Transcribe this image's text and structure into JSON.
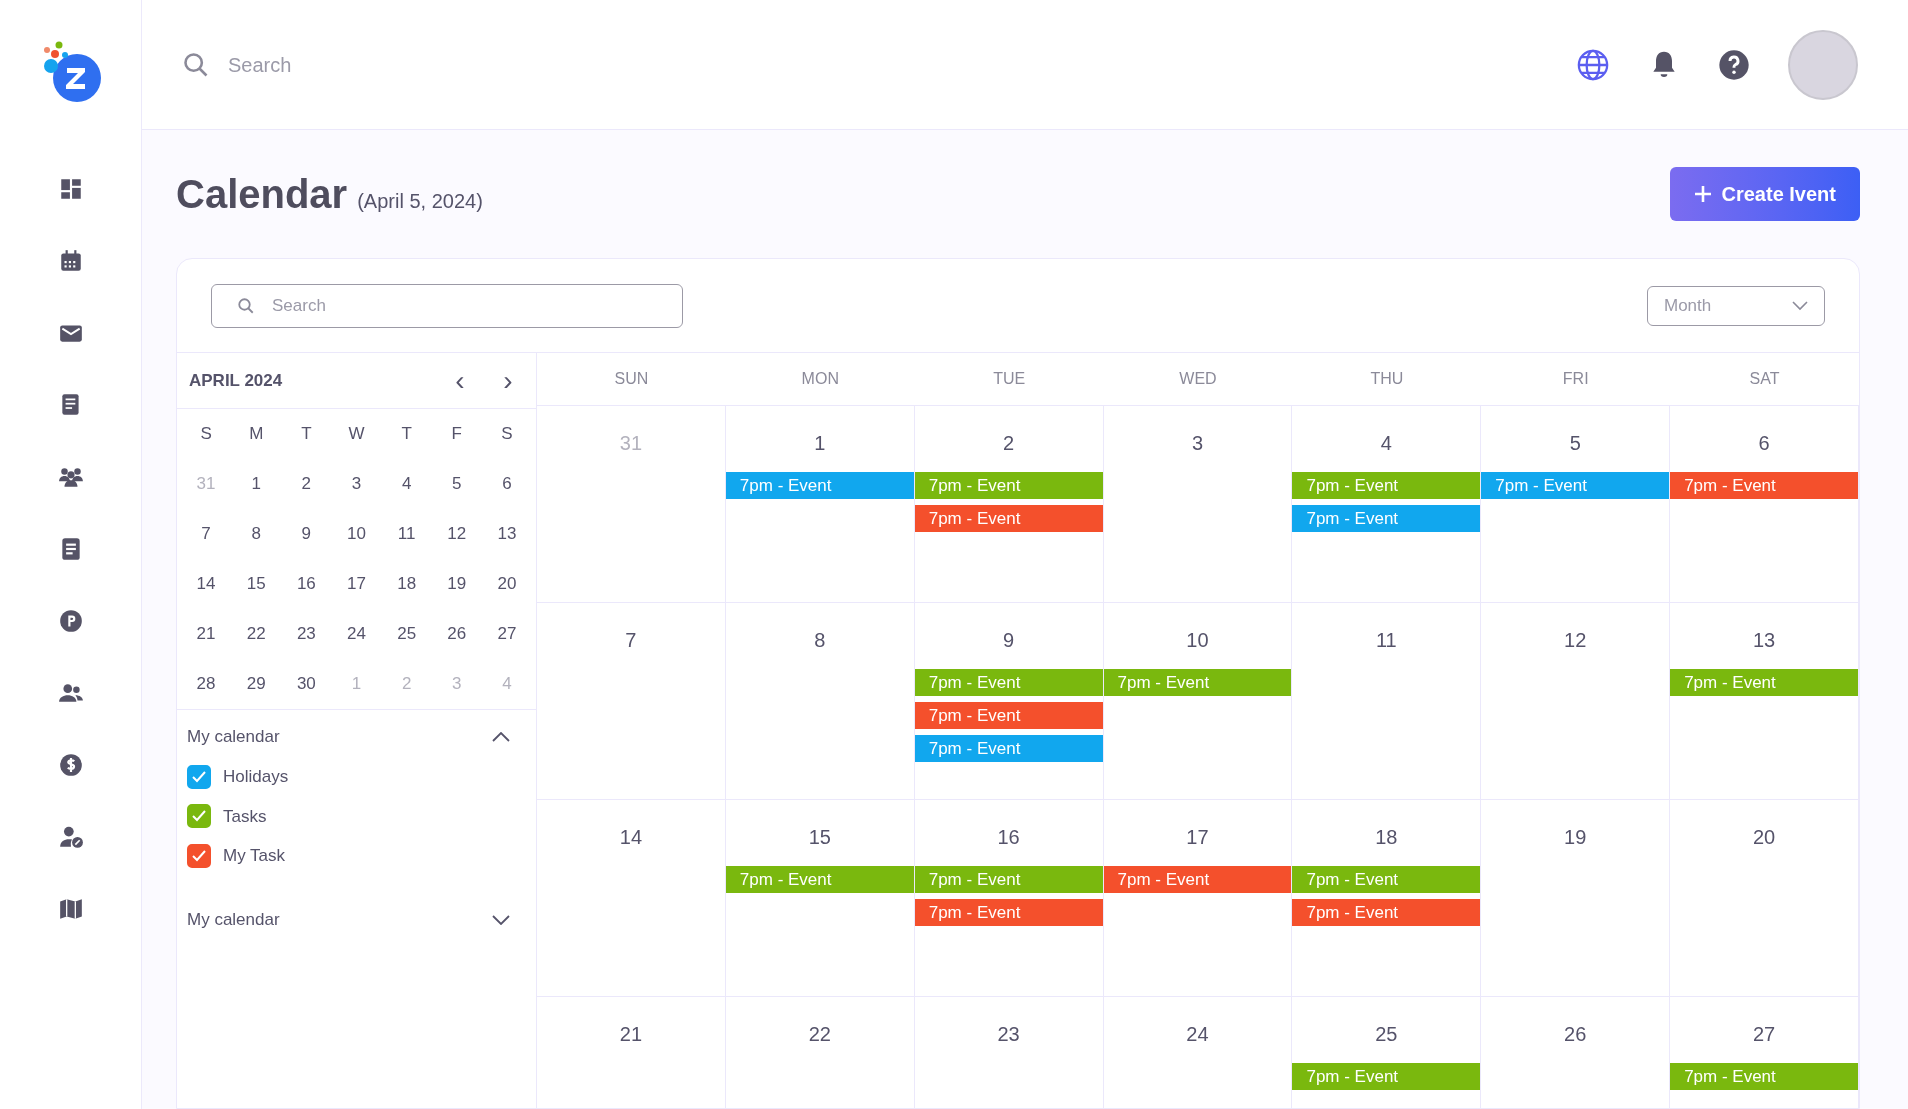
{
  "topbar": {
    "search": {
      "placeholder": "Search"
    }
  },
  "page": {
    "title": "Calendar",
    "date": "(April 5, 2024)",
    "create_button": "Create Ivent"
  },
  "toolbar": {
    "search": {
      "placeholder": "Search"
    },
    "view": {
      "value": "Month"
    }
  },
  "mini_calendar": {
    "month": "APRIL 2024",
    "prev": "‹",
    "next": "›",
    "weekdays": [
      "S",
      "M",
      "T",
      "W",
      "T",
      "F",
      "S"
    ],
    "weeks": [
      [
        {
          "label": "31",
          "muted": true
        },
        {
          "label": "1",
          "muted": false
        },
        {
          "label": "2",
          "muted": false
        },
        {
          "label": "3",
          "muted": false
        },
        {
          "label": "4",
          "muted": false
        },
        {
          "label": "5",
          "muted": false
        },
        {
          "label": "6",
          "muted": false
        }
      ],
      [
        {
          "label": "7",
          "muted": false
        },
        {
          "label": "8",
          "muted": false
        },
        {
          "label": "9",
          "muted": false
        },
        {
          "label": "10",
          "muted": false
        },
        {
          "label": "11",
          "muted": false
        },
        {
          "label": "12",
          "muted": false
        },
        {
          "label": "13",
          "muted": false
        }
      ],
      [
        {
          "label": "14",
          "muted": false
        },
        {
          "label": "15",
          "muted": false
        },
        {
          "label": "16",
          "muted": false
        },
        {
          "label": "17",
          "muted": false
        },
        {
          "label": "18",
          "muted": false
        },
        {
          "label": "19",
          "muted": false
        },
        {
          "label": "20",
          "muted": false
        }
      ],
      [
        {
          "label": "21",
          "muted": false
        },
        {
          "label": "22",
          "muted": false
        },
        {
          "label": "23",
          "muted": false
        },
        {
          "label": "24",
          "muted": false
        },
        {
          "label": "25",
          "muted": false
        },
        {
          "label": "26",
          "muted": false
        },
        {
          "label": "27",
          "muted": false
        }
      ],
      [
        {
          "label": "28",
          "muted": false
        },
        {
          "label": "29",
          "muted": false
        },
        {
          "label": "30",
          "muted": false
        },
        {
          "label": "1",
          "muted": true
        },
        {
          "label": "2",
          "muted": true
        },
        {
          "label": "3",
          "muted": true
        },
        {
          "label": "4",
          "muted": true
        }
      ]
    ]
  },
  "calendar_groups": [
    {
      "title": "My calendar",
      "expanded": true,
      "items": [
        {
          "label": "Holidays",
          "checked": true,
          "color": "#11a7ee"
        },
        {
          "label": "Tasks",
          "checked": true,
          "color": "#7ab80e"
        },
        {
          "label": "My Task",
          "checked": true,
          "color": "#f4502c"
        }
      ]
    },
    {
      "title": "My calendar",
      "expanded": false
    }
  ],
  "month_view": {
    "columns": [
      "SUN",
      "MON",
      "TUE",
      "WED",
      "THU",
      "FRI",
      "SAT"
    ],
    "weeks": [
      [
        {
          "label": "31",
          "muted": true
        },
        {
          "label": "1",
          "muted": false,
          "events": [
            {
              "label": "7pm - Event",
              "color": "#11a7ee"
            }
          ]
        },
        {
          "label": "2",
          "muted": false,
          "events": [
            {
              "label": "7pm - Event",
              "color": "#7ab80e"
            },
            {
              "label": "7pm - Event",
              "color": "#f4502c"
            }
          ]
        },
        {
          "label": "3",
          "muted": false
        },
        {
          "label": "4",
          "muted": false,
          "events": [
            {
              "label": "7pm - Event",
              "color": "#7ab80e"
            },
            {
              "label": "7pm - Event",
              "color": "#11a7ee"
            }
          ]
        },
        {
          "label": "5",
          "muted": false,
          "events": [
            {
              "label": "7pm - Event",
              "color": "#11a7ee"
            }
          ]
        },
        {
          "label": "6",
          "muted": false,
          "events": [
            {
              "label": "7pm - Event",
              "color": "#f4502c"
            }
          ]
        }
      ],
      [
        {
          "label": "7",
          "muted": false
        },
        {
          "label": "8",
          "muted": false
        },
        {
          "label": "9",
          "muted": false,
          "events": [
            {
              "label": "7pm - Event",
              "color": "#7ab80e"
            },
            {
              "label": "7pm - Event",
              "color": "#f4502c"
            },
            {
              "label": "7pm - Event",
              "color": "#11a7ee"
            }
          ]
        },
        {
          "label": "10",
          "muted": false,
          "events": [
            {
              "label": "7pm - Event",
              "color": "#7ab80e"
            }
          ]
        },
        {
          "label": "11",
          "muted": false
        },
        {
          "label": "12",
          "muted": false
        },
        {
          "label": "13",
          "muted": false,
          "events": [
            {
              "label": "7pm - Event",
              "color": "#7ab80e"
            }
          ]
        }
      ],
      [
        {
          "label": "14",
          "muted": false
        },
        {
          "label": "15",
          "muted": false,
          "events": [
            {
              "label": "7pm - Event",
              "color": "#7ab80e"
            }
          ]
        },
        {
          "label": "16",
          "muted": false,
          "events": [
            {
              "label": "7pm - Event",
              "color": "#7ab80e"
            },
            {
              "label": "7pm - Event",
              "color": "#f4502c"
            }
          ]
        },
        {
          "label": "17",
          "muted": false,
          "events": [
            {
              "label": "7pm - Event",
              "color": "#f4502c"
            }
          ]
        },
        {
          "label": "18",
          "muted": false,
          "events": [
            {
              "label": "7pm - Event",
              "color": "#7ab80e"
            },
            {
              "label": "7pm - Event",
              "color": "#f4502c"
            }
          ]
        },
        {
          "label": "19",
          "muted": false
        },
        {
          "label": "20",
          "muted": false
        }
      ],
      [
        {
          "label": "21",
          "muted": false
        },
        {
          "label": "22",
          "muted": false
        },
        {
          "label": "23",
          "muted": false
        },
        {
          "label": "24",
          "muted": false
        },
        {
          "label": "25",
          "muted": false,
          "events": [
            {
              "label": "7pm - Event",
              "color": "#7ab80e"
            }
          ]
        },
        {
          "label": "26",
          "muted": false
        },
        {
          "label": "27",
          "muted": false,
          "events": [
            {
              "label": "7pm - Event",
              "color": "#7ab80e"
            }
          ]
        }
      ]
    ]
  }
}
